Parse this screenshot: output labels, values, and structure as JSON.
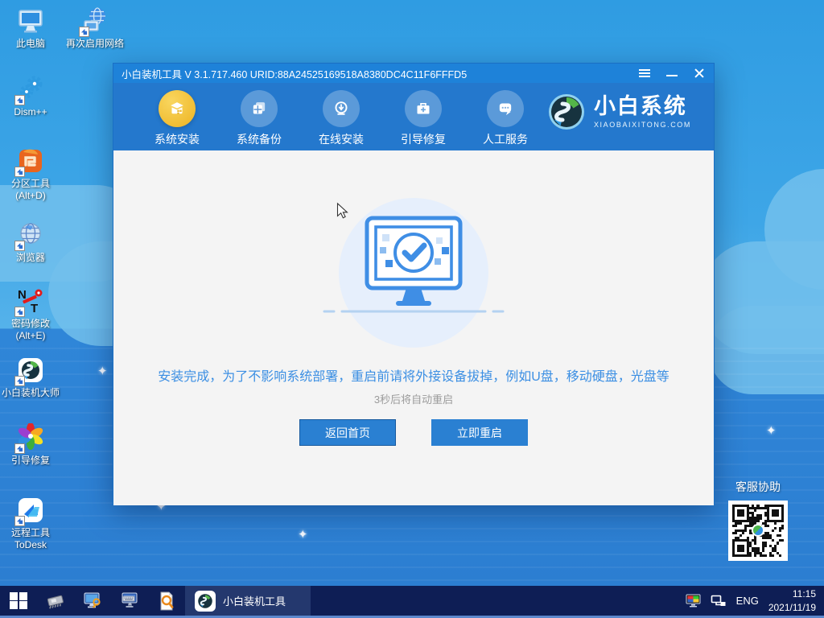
{
  "desktop": {
    "icons": [
      {
        "label": "此电脑",
        "icon": "this-pc-icon"
      },
      {
        "label": "再次启用网络",
        "icon": "enable-network-icon"
      },
      {
        "label": "Dism++",
        "icon": "dism-gears-icon"
      },
      {
        "label": "分区工具\n(Alt+D)",
        "icon": "partition-tool-icon"
      },
      {
        "label": "浏览器",
        "icon": "browser-globe-icon"
      },
      {
        "label": "密码修改\n(Alt+E)",
        "icon": "password-reset-icon"
      },
      {
        "label": "小白装机大师",
        "icon": "xiaobai-master-icon"
      },
      {
        "label": "引导修复",
        "icon": "boot-repair-pinwheel-icon"
      },
      {
        "label": "远程工具\nToDesk",
        "icon": "todesk-icon"
      }
    ]
  },
  "window": {
    "title": "小白装机工具 V 3.1.717.460 URID:88A24525169518A8380DC4C11F6FFFD5",
    "nav": {
      "items": [
        {
          "label": "系统安装",
          "icon": "install-box-icon",
          "active": true
        },
        {
          "label": "系统备份",
          "icon": "backup-windows-icon",
          "active": false
        },
        {
          "label": "在线安装",
          "icon": "online-download-icon",
          "active": false
        },
        {
          "label": "引导修复",
          "icon": "repair-toolbox-icon",
          "active": false
        },
        {
          "label": "人工服务",
          "icon": "service-chat-icon",
          "active": false
        }
      ]
    },
    "brand": {
      "name": "小白系统",
      "domain": "XIAOBAIXITONG.COM"
    },
    "main": {
      "message": "安装完成，为了不影响系统部署，重启前请将外接设备拔掉，例如U盘，移动硬盘，光盘等",
      "countdown": "3秒后将自动重启",
      "back_button": "返回首页",
      "restart_button": "立即重启"
    }
  },
  "support": {
    "label": "客服协助"
  },
  "taskbar": {
    "active_task": "小白装机工具",
    "language": "ENG",
    "time": "11:15",
    "date": "2021/11/19"
  },
  "colors": {
    "titlebar_blue": "#1e82d9",
    "nav_blue": "#2478cd",
    "active_tab_yellow": "#edb321",
    "button_blue": "#2a80d2",
    "message_blue": "#3c8fe3",
    "content_gray": "#f4f4f4",
    "taskbar_navy": "#0e1e55",
    "taskbar_underline": "#5b87cc",
    "sky_blue": "#2f9ce2",
    "sea_blue": "#2f86d8"
  }
}
